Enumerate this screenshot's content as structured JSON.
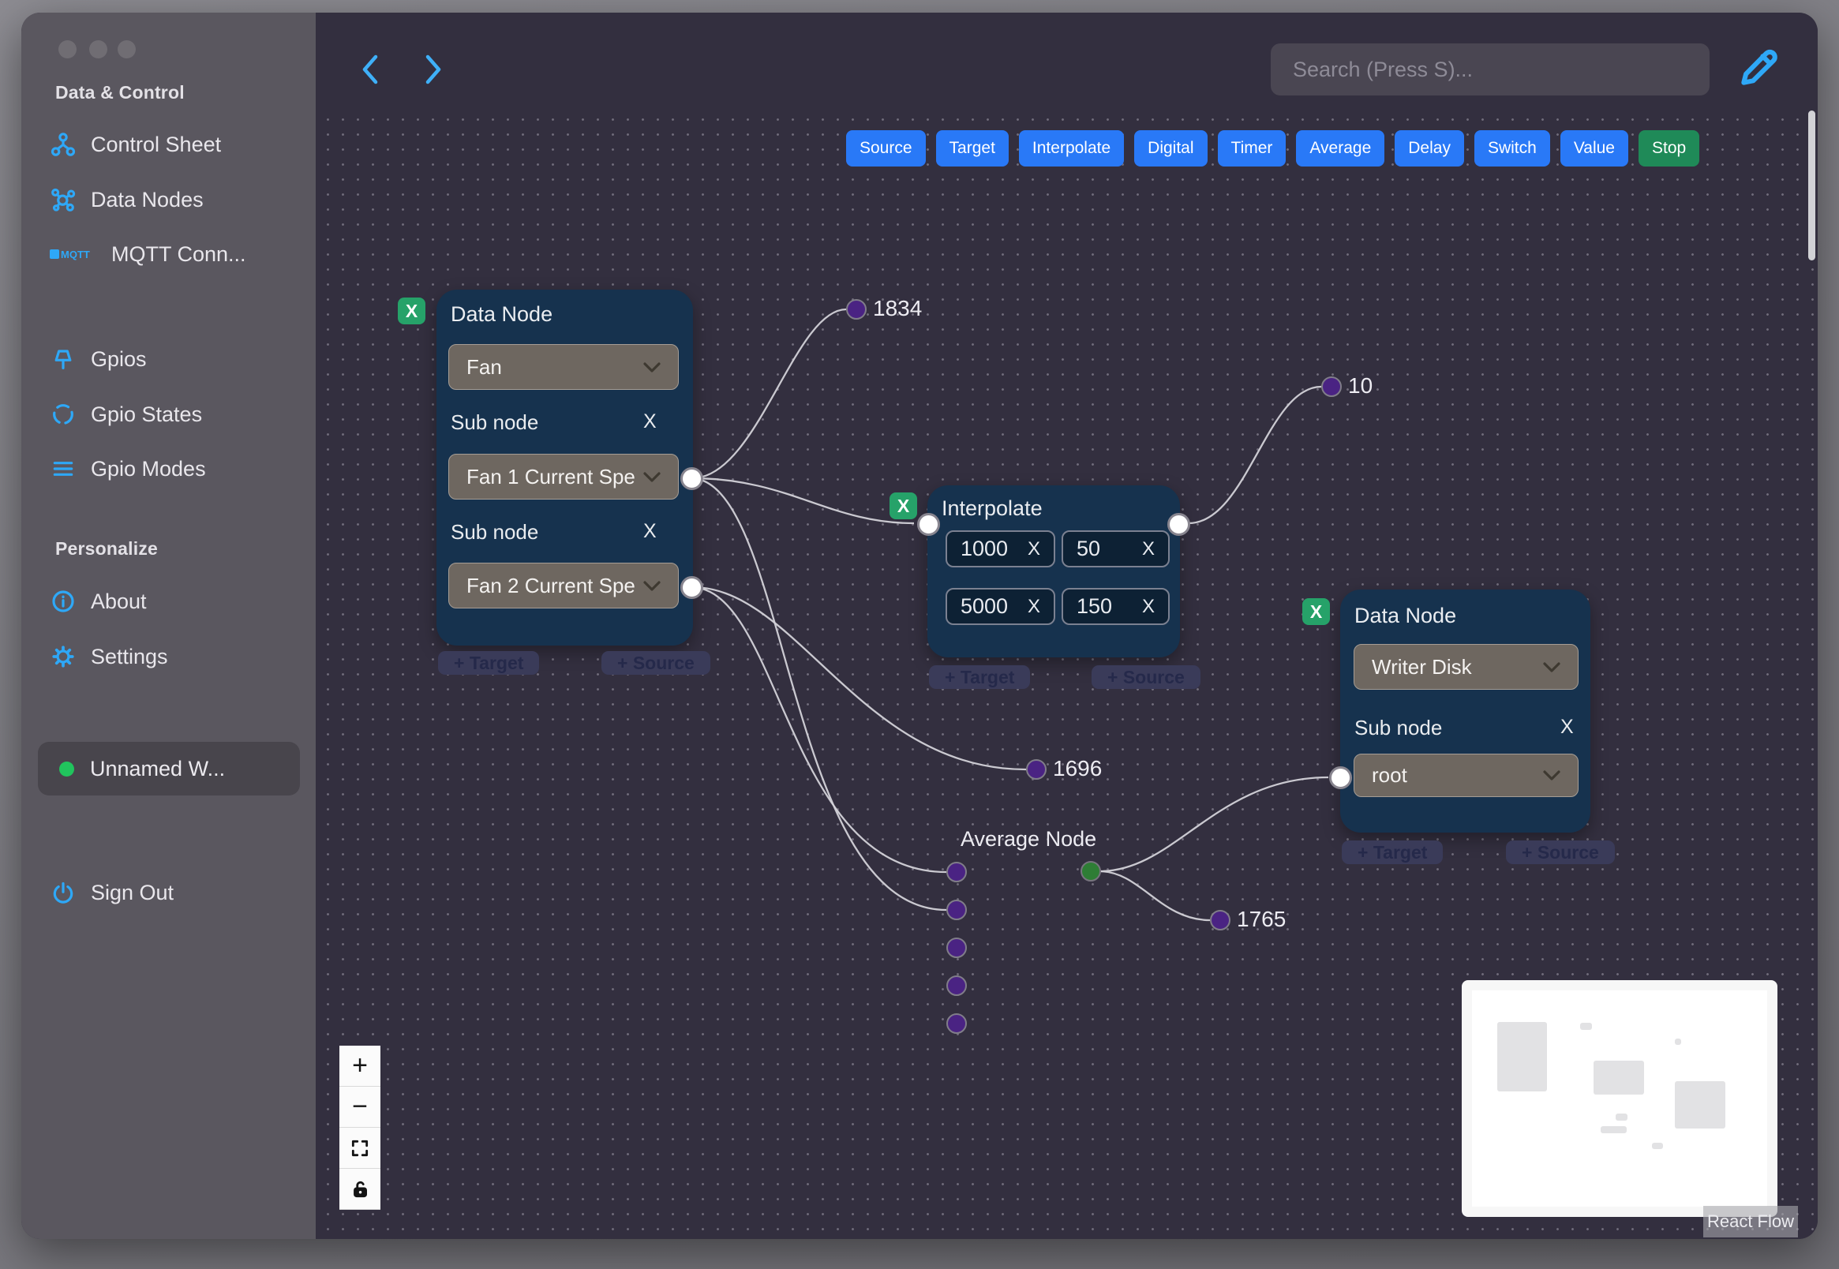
{
  "sidebar": {
    "headers": [
      "Data & Control",
      "Personalize"
    ],
    "items": [
      {
        "label": "Control Sheet"
      },
      {
        "label": "Data Nodes"
      },
      {
        "label": "MQTT Conn..."
      },
      {
        "label": "Gpios"
      },
      {
        "label": "Gpio States"
      },
      {
        "label": "Gpio Modes"
      },
      {
        "label": "About"
      },
      {
        "label": "Settings"
      },
      {
        "label": "Unnamed W..."
      },
      {
        "label": "Sign Out"
      }
    ]
  },
  "topbar": {
    "search_placeholder": "Search (Press S)..."
  },
  "toolbar": {
    "buttons": [
      "Source",
      "Target",
      "Interpolate",
      "Digital",
      "Timer",
      "Average",
      "Delay",
      "Switch",
      "Value",
      "Stop"
    ]
  },
  "canvas": {
    "nodes": {
      "fan": {
        "title": "Data Node",
        "device": "Fan",
        "sub1_label": "Sub node",
        "sub1_value": "Fan 1 Current Spe",
        "sub2_label": "Sub node",
        "sub2_value": "Fan 2 Current Spe",
        "remove": "X",
        "sub_close": "X",
        "add_target": "+ Target",
        "add_source": "+ Source"
      },
      "interpolate": {
        "title": "Interpolate",
        "v1": "1000",
        "v2": "50",
        "v3": "5000",
        "v4": "150",
        "remove": "X",
        "clear": "X",
        "add_target": "+ Target",
        "add_source": "+ Source"
      },
      "writer": {
        "title": "Data Node",
        "device": "Writer Disk",
        "sub_label": "Sub node",
        "sub_value": "root",
        "remove": "X",
        "sub_close": "X",
        "add_target": "+ Target",
        "add_source": "+ Source"
      },
      "average": {
        "title": "Average Node"
      }
    },
    "edge_values": {
      "a": "1834",
      "b": "10",
      "c": "1696",
      "d": "1765"
    },
    "attribution": "React Flow"
  },
  "colors": {
    "accent_blue": "#2ea8f7",
    "button_blue": "#2979f7",
    "stop_green": "#1f8a58",
    "node_bg": "#16324e",
    "handle_purple": "#4a2383",
    "handle_green": "#2e7d35"
  }
}
